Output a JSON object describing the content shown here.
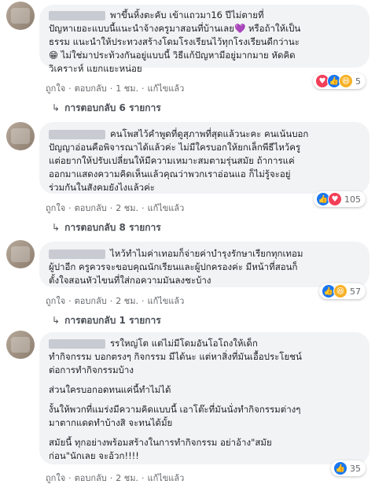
{
  "comments": [
    {
      "text": "พาขึ้นหิ้งตะคับ เข้าแถวมา16 ปีไม่ตายที่\nปัญหาเยอะแบบนี้แนะนำจ้างครูมาสอนที่บ้านเลย💜 หรือถ้าให้เป็น\nธรรม แนะนำให้ประทวงสร้างโดมโรงเรียนไว้ทุกโรงเรียนดีกว่านะ\n😁 ไม่ใช่มาประท้วงกันอยู่แบบนี้ วิธีแก้ปัญหามีอยู่มากมาย หัดคิด\nวิเคราะห์ แยกแยะหน่อย",
      "actions": [
        "ถูกใจ",
        "ตอบกลับ",
        "1 ชม.",
        "แก้ไขแล้ว"
      ],
      "reaction_count": "5",
      "reaction_icons": [
        "love-icon",
        "like-icon",
        "haha-icon"
      ],
      "replies": "การตอบกลับ 6 รายการ"
    },
    {
      "text": "คนโพสไว้คำพูดที่ดูสุภาพที่สุดแล้วนะคะ คนเน้นบอก\nปัญญาอ่อนคือพิจารณาได้แล้วค่ะ ไม่มีใครบอกให้ยกเล็กพีธีไหว้ครู\nแต่อยากให้ปรับเปลี่ยนให้มีความเหมาะสมตามรุ่นสมัย ถ้าการแค่\nออกมาแสดงความคิดเห็นแล้วคุณว่าพวกเราอ่อนแอ ก็ไม่รู้จะอยู่\nร่วมกันในสังคมยังไงแล้วค่ะ",
      "actions": [
        "ถูกใจ",
        "ตอบกลับ",
        "2 ชม.",
        "แก้ไขแล้ว"
      ],
      "reaction_count": "105",
      "reaction_icons": [
        "like-icon",
        "love-icon"
      ],
      "replies": "การตอบกลับ 8 รายการ"
    },
    {
      "text": "ไหว้ทำไมค่าเทอมก็จ่ายค่าบำรุงรักษาเรียกทุกเทอม\nผู้ปาอีก ครูควรจะขอบคุณนักเรียนและผู้ปกครองค่ะ มีหน้าที่สอนก็\nตั้งใจสอนหัวไขนที่ใส่กอความมันลงชะบ้าง",
      "actions": [
        "ถูกใจ",
        "ตอบกลับ",
        "2 ชม.",
        "แก้ไขแล้ว"
      ],
      "reaction_count": "57",
      "reaction_icons": [
        "like-icon",
        "haha-icon"
      ],
      "replies": "การตอบกลับ 1 รายการ"
    },
    {
      "paragraphs": [
        "รรใหญ่โต แต่ไม่มีโดมอันโอโถงให้เด็ก\nทำกิจกรรม บอกตรงๆ กิจกรรม มีได้นะ แต่หาสิ่งที่มันเอื้อประโยชน์\nต่อการทำกิจกรรมบ้าง",
        "ส่วนใครบอกอดทนแค่นี้ทำไม่ได้",
        "งั้นให้พวกที่แมร่งมีความคิดแบบนี้ เอาโต๊ะที่มันนั่งทำกิจกรรมต่างๆ\nมาตากแดดทำบ้างสิ จะทนได้มั้ย",
        "สมัยนี้ ทุกอย่างพร้อมสร้างในการทำกิจกรรม อย่าอ้าง\"สมัย\nก่อน\"นักเลย จะอ้วก!!!!"
      ],
      "actions": [
        "ถูกใจ",
        "ตอบกลับ",
        "2 ชม.",
        "แก้ไขแล้ว"
      ],
      "reaction_count": "35",
      "reaction_icons": [
        "like-icon"
      ]
    }
  ]
}
